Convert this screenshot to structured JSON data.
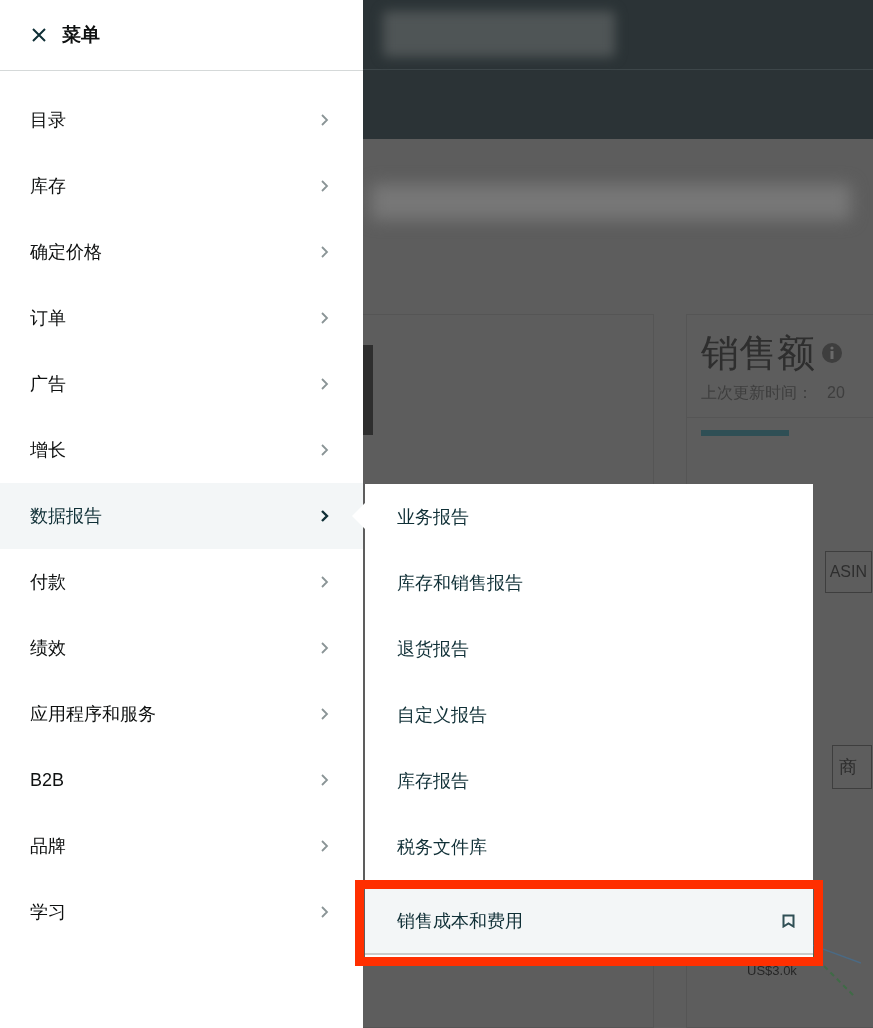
{
  "menu": {
    "title": "菜单",
    "items": [
      {
        "label": "目录",
        "selected": false
      },
      {
        "label": "库存",
        "selected": false
      },
      {
        "label": "确定价格",
        "selected": false
      },
      {
        "label": "订单",
        "selected": false
      },
      {
        "label": "广告",
        "selected": false
      },
      {
        "label": "增长",
        "selected": false
      },
      {
        "label": "数据报告",
        "selected": true
      },
      {
        "label": "付款",
        "selected": false
      },
      {
        "label": "绩效",
        "selected": false
      },
      {
        "label": "应用程序和服务",
        "selected": false
      },
      {
        "label": "B2B",
        "selected": false
      },
      {
        "label": "品牌",
        "selected": false
      },
      {
        "label": "学习",
        "selected": false
      }
    ]
  },
  "submenu": {
    "items": [
      {
        "label": "业务报告",
        "selected": false,
        "annotated": false
      },
      {
        "label": "库存和销售报告",
        "selected": false,
        "annotated": false
      },
      {
        "label": "退货报告",
        "selected": false,
        "annotated": false
      },
      {
        "label": "自定义报告",
        "selected": false,
        "annotated": false
      },
      {
        "label": "库存报告",
        "selected": false,
        "annotated": false
      },
      {
        "label": "税务文件库",
        "selected": false,
        "annotated": false
      },
      {
        "label": "销售成本和费用",
        "selected": true,
        "annotated": true
      }
    ]
  },
  "background": {
    "sales_title": "销售额",
    "updated_label": "上次更新时间：",
    "updated_value": "20",
    "asin_button": "ASIN",
    "product_button": "商",
    "axis_label": "US$3.0k"
  }
}
